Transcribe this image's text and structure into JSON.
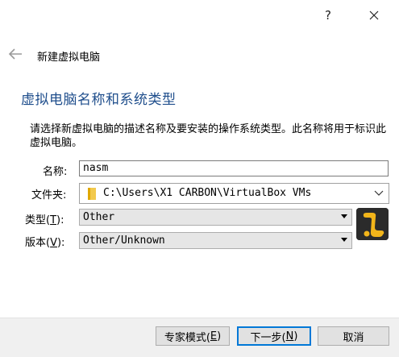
{
  "titlebar": {
    "help_label": "?"
  },
  "nav": {
    "title": "新建虚拟电脑"
  },
  "section_title": "虚拟电脑名称和系统类型",
  "description": "请选择新虚拟电脑的描述名称及要安装的操作系统类型。此名称将用于标识此虚拟电脑。",
  "form": {
    "name_label": "名称:",
    "name_value": "nasm",
    "folder_label": "文件夹:",
    "folder_value": "C:\\Users\\X1 CARBON\\VirtualBox VMs",
    "type_label_prefix": "类型(",
    "type_label_key": "T",
    "type_label_suffix": "):",
    "type_value": "Other",
    "version_label_prefix": "版本(",
    "version_label_key": "V",
    "version_label_suffix": "):",
    "version_value": "Other/Unknown"
  },
  "footer": {
    "expert_prefix": "专家模式(",
    "expert_key": "E",
    "expert_suffix": ")",
    "next_prefix": "下一步(",
    "next_key": "N",
    "next_suffix": ")",
    "cancel": "取消"
  },
  "icons": {
    "help": "help-icon",
    "close": "close-icon",
    "back": "back-arrow-icon",
    "folder": "folder-icon",
    "os_type": "os-other-icon"
  },
  "colors": {
    "section_title": "#1f4e8c",
    "focus_border": "#0078d7",
    "os_icon_yellow": "#f2b51a"
  }
}
